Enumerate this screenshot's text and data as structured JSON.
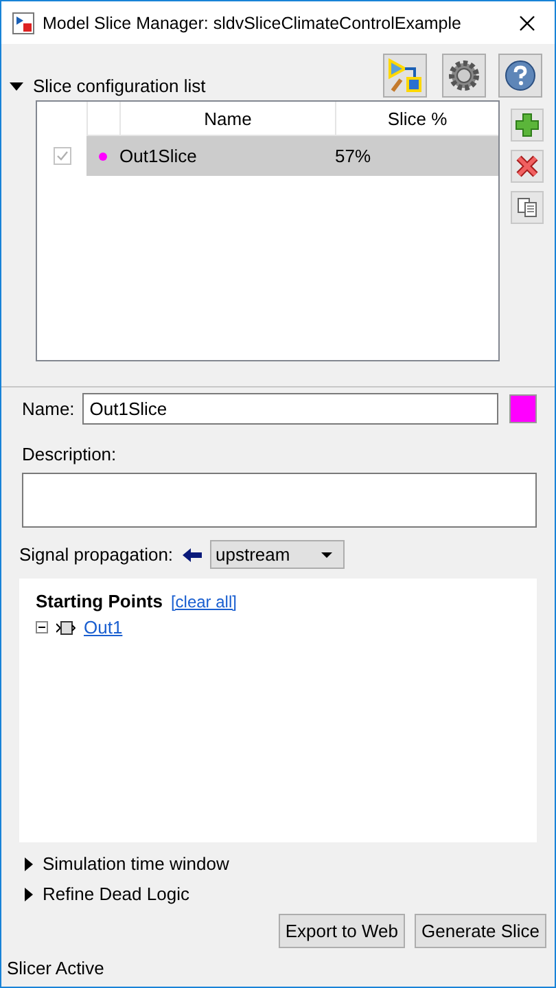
{
  "window": {
    "title": "Model Slice Manager: sldvSliceClimateControlExample"
  },
  "slice_configuration": {
    "label": "Slice configuration list",
    "expanded": true,
    "columns": [
      "Name",
      "Slice %"
    ],
    "rows": [
      {
        "checked": true,
        "color": "#ff00ff",
        "name": "Out1Slice",
        "slice": "57%",
        "selected": true
      }
    ]
  },
  "details": {
    "name_label": "Name:",
    "name_value": "Out1Slice",
    "color": "#ff00ff",
    "description_label": "Description:",
    "propagation_label": "Signal propagation:",
    "propagation_value": "upstream"
  },
  "starting_points": {
    "title": "Starting Points",
    "clear_link": "[clear all]",
    "items": [
      {
        "label": "Out1",
        "expanded": true
      }
    ]
  },
  "sections": [
    {
      "label": "Simulation time window",
      "expanded": false
    },
    {
      "label": "Refine Dead Logic",
      "expanded": false
    }
  ],
  "buttons": [
    "Export to Web",
    "Generate Slice"
  ],
  "status_bar": "Slicer Active"
}
